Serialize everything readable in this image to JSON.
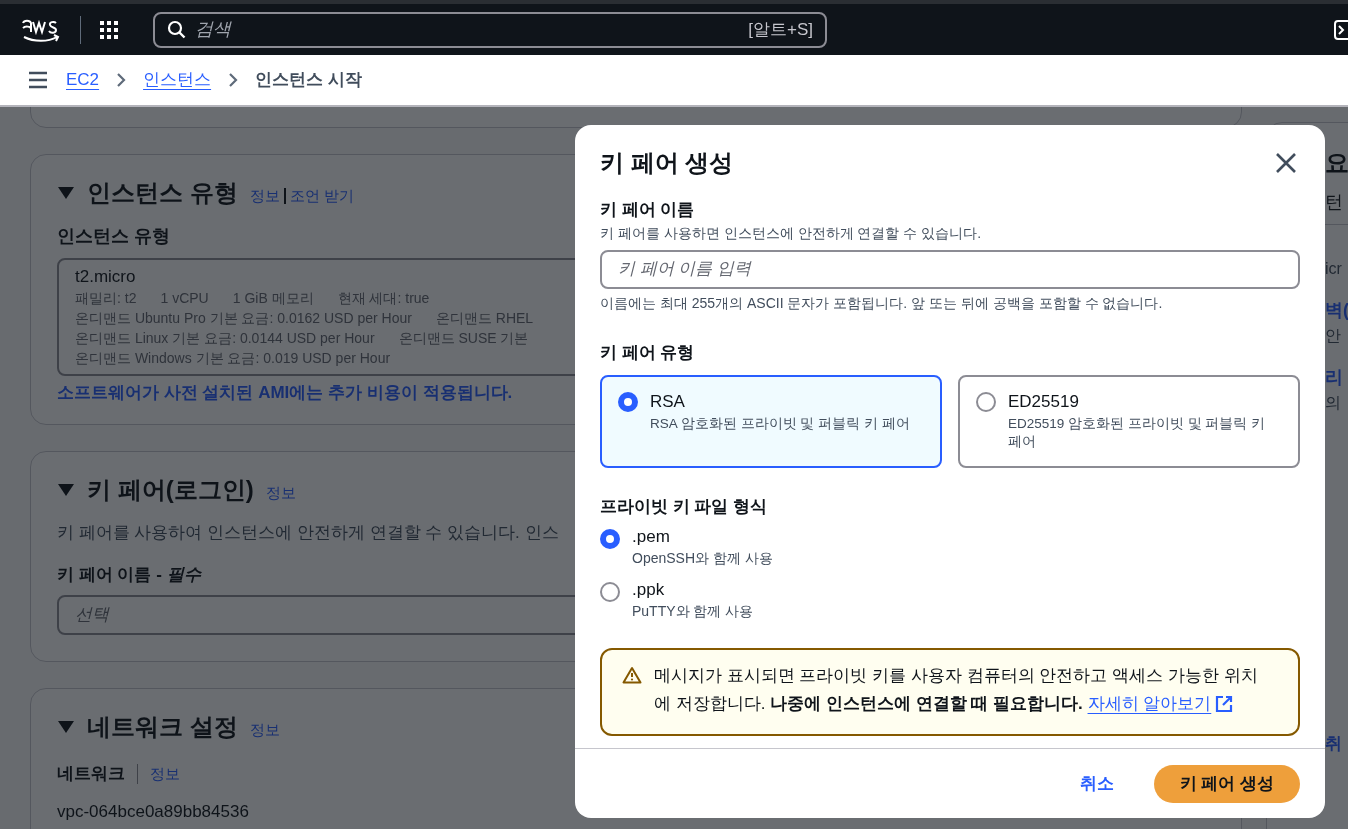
{
  "nav": {
    "search_placeholder": "검색",
    "search_shortcut": "[알트+S]"
  },
  "breadcrumbs": [
    {
      "label": "EC2",
      "link": true
    },
    {
      "label": "인스턴스",
      "link": true
    },
    {
      "label": "인스턴스 시작",
      "link": false
    }
  ],
  "instance_type": {
    "title": "인스턴스 유형",
    "info": "정보",
    "advice": "조언 받기",
    "field_label": "인스턴스 유형",
    "value": "t2.micro",
    "details": [
      [
        "패밀리: t2",
        "1 vCPU",
        "1 GiB 메모리",
        "현재 세대: true"
      ],
      [
        "온디맨드 Ubuntu Pro 기본 요금: 0.0162 USD per Hour",
        "온디맨드 RHEL"
      ],
      [
        "온디맨드 Linux 기본 요금: 0.0144 USD per Hour",
        "온디맨드 SUSE 기본"
      ],
      [
        "온디맨드 Windows 기본 요금: 0.019 USD per Hour"
      ]
    ],
    "note": "소프트웨어가 사전 설치된 AMI에는 추가 비용이 적용됩니다."
  },
  "key_pair_section": {
    "title": "키 페어(로그인)",
    "info": "정보",
    "description": "키 페어를 사용하여 인스턴스에 안전하게 연결할 수 있습니다. 인스",
    "field_label": "키 페어 이름 - ",
    "required": "필수",
    "placeholder": "선택"
  },
  "network_section": {
    "title": "네트워크 설정",
    "info": "정보",
    "field_label": "네트워크",
    "field_info": "정보",
    "value": "vpc-064bce0a89bb84536"
  },
  "right_panel": {
    "lines": [
      {
        "text": "요",
        "kind": "heading"
      },
      {
        "text": "턴",
        "kind": "tab"
      },
      {
        "text": "icr",
        "kind": "text"
      },
      {
        "text": "벽(",
        "kind": "link"
      },
      {
        "text": "안",
        "kind": "text"
      },
      {
        "text": "리",
        "kind": "link"
      },
      {
        "text": "의",
        "kind": "text"
      }
    ],
    "footer": "취"
  },
  "modal": {
    "title": "키 페어 생성",
    "name_label": "키 페어 이름",
    "name_description": "키 페어를 사용하면 인스턴스에 안전하게 연결할 수 있습니다.",
    "name_placeholder": "키 페어 이름 입력",
    "name_constraint": "이름에는 최대 255개의 ASCII 문자가 포함됩니다. 앞 또는 뒤에 공백을 포함할 수 없습니다.",
    "type_label": "키 페어 유형",
    "types": [
      {
        "label": "RSA",
        "description": "RSA 암호화된 프라이빗 및 퍼블릭 키 페어",
        "selected": true
      },
      {
        "label": "ED25519",
        "description": "ED25519 암호화된 프라이빗 및 퍼블릭 키 페어",
        "selected": false
      }
    ],
    "format_label": "프라이빗 키 파일 형식",
    "formats": [
      {
        "label": ".pem",
        "description": "OpenSSH와 함께 사용",
        "selected": true
      },
      {
        "label": ".ppk",
        "description": "PuTTY와 함께 사용",
        "selected": false
      }
    ],
    "alert": "메시지가 표시되면 프라이빗 키를 사용자 컴퓨터의 안전하고 액세스 가능한 위치에 저장합니다. **나중에 인스턴스에 연결할 때 필요합니다.**",
    "alert_link": "자세히 알아보기",
    "cancel": "취소",
    "submit": "키 페어 생성"
  }
}
